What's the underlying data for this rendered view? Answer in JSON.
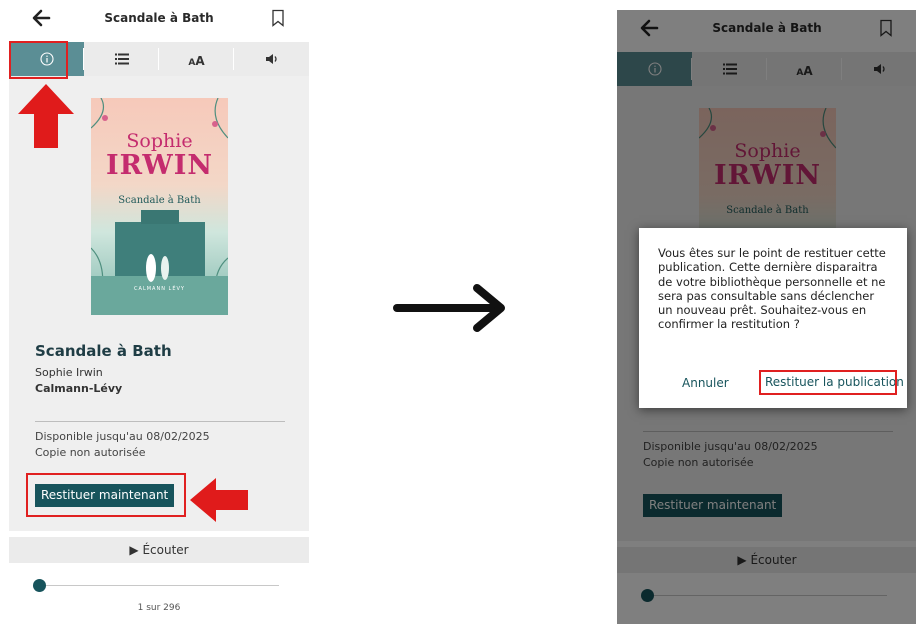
{
  "app": {
    "title": "Scandale à Bath",
    "toolbar": {
      "info_icon": "info-icon",
      "toc_icon": "list-icon",
      "font_label": "AA",
      "audio_icon": "speaker-icon"
    }
  },
  "book": {
    "cover": {
      "author_first": "Sophie",
      "author_last": "IRWIN",
      "title": "Scandale à Bath",
      "publisher": "CALMANN LÉVY"
    },
    "title": "Scandale à Bath",
    "author": "Sophie Irwin",
    "publisher": "Calmann-Lévy",
    "availability": "Disponible jusqu'au 08/02/2025",
    "copy_status": "Copie non autorisée",
    "return_button": "Restituer maintenant"
  },
  "player": {
    "listen_label": "Écouter",
    "progress": 0.0,
    "page_indicator": "1 sur 296"
  },
  "dialog": {
    "message": "Vous êtes sur le point de restituer cette publication. Cette dernière disparaitra de votre bibliothèque personnelle et ne sera pas consultable sans déclencher un nouveau prêt. Souhaitez-vous en confirmer la restitution ?",
    "cancel_label": "Annuler",
    "confirm_label": "Restituer la publication"
  },
  "colors": {
    "accent": "#17545c",
    "active_tab": "#5b8e95",
    "highlight": "#e02020",
    "cover_title": "#c42c6e"
  }
}
